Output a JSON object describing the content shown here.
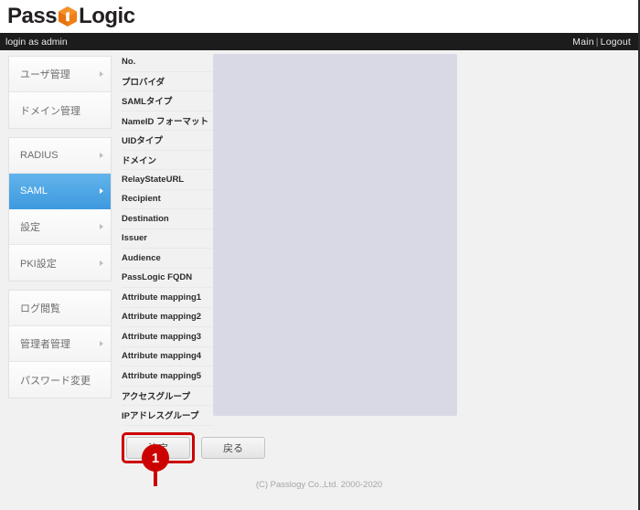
{
  "brand": {
    "name_part1": "Pass",
    "name_part2": "Logic",
    "cube_icon": "orange-cube-icon",
    "accent_color": "#ef7b10"
  },
  "navbar": {
    "session_text": "login as admin",
    "main_link": "Main",
    "separator": "|",
    "logout_link": "Logout",
    "background_color": "#1c1c1c"
  },
  "sidebar": {
    "active_color": "#3e9ade",
    "groups": [
      {
        "items": [
          {
            "label": "ユーザ管理",
            "has_arrow": true,
            "active": false
          },
          {
            "label": "ドメイン管理",
            "has_arrow": false,
            "active": false
          }
        ]
      },
      {
        "items": [
          {
            "label": "RADIUS",
            "has_arrow": true,
            "active": false
          },
          {
            "label": "SAML",
            "has_arrow": true,
            "active": true
          },
          {
            "label": "設定",
            "has_arrow": true,
            "active": false
          },
          {
            "label": "PKI設定",
            "has_arrow": true,
            "active": false
          }
        ]
      },
      {
        "items": [
          {
            "label": "ログ閲覧",
            "has_arrow": false,
            "active": false
          },
          {
            "label": "管理者管理",
            "has_arrow": true,
            "active": false
          },
          {
            "label": "パスワード変更",
            "has_arrow": false,
            "active": false
          }
        ]
      }
    ]
  },
  "form": {
    "fields": [
      {
        "label": "No."
      },
      {
        "label": "プロバイダ"
      },
      {
        "label": "SAMLタイプ"
      },
      {
        "label": "NameID フォーマット"
      },
      {
        "label": "UIDタイプ"
      },
      {
        "label": "ドメイン"
      },
      {
        "label": "RelayStateURL"
      },
      {
        "label": "Recipient"
      },
      {
        "label": "Destination"
      },
      {
        "label": "Issuer"
      },
      {
        "label": "Audience"
      },
      {
        "label": "PassLogic FQDN"
      },
      {
        "label": "Attribute mapping1"
      },
      {
        "label": "Attribute mapping2"
      },
      {
        "label": "Attribute mapping3"
      },
      {
        "label": "Attribute mapping4"
      },
      {
        "label": "Attribute mapping5"
      },
      {
        "label": "アクセスグループ"
      },
      {
        "label": "IPアドレスグループ"
      }
    ],
    "value_panel": {
      "state": "redacted",
      "color": "#d9d9e6"
    }
  },
  "buttons": {
    "submit_label": "決定",
    "back_label": "戻る"
  },
  "annotation": {
    "badge_number": "1",
    "color": "#cc0000",
    "target": "submit-button"
  },
  "footer": {
    "copyright": "(C) Passlogy Co.,Ltd. 2000-2020"
  }
}
